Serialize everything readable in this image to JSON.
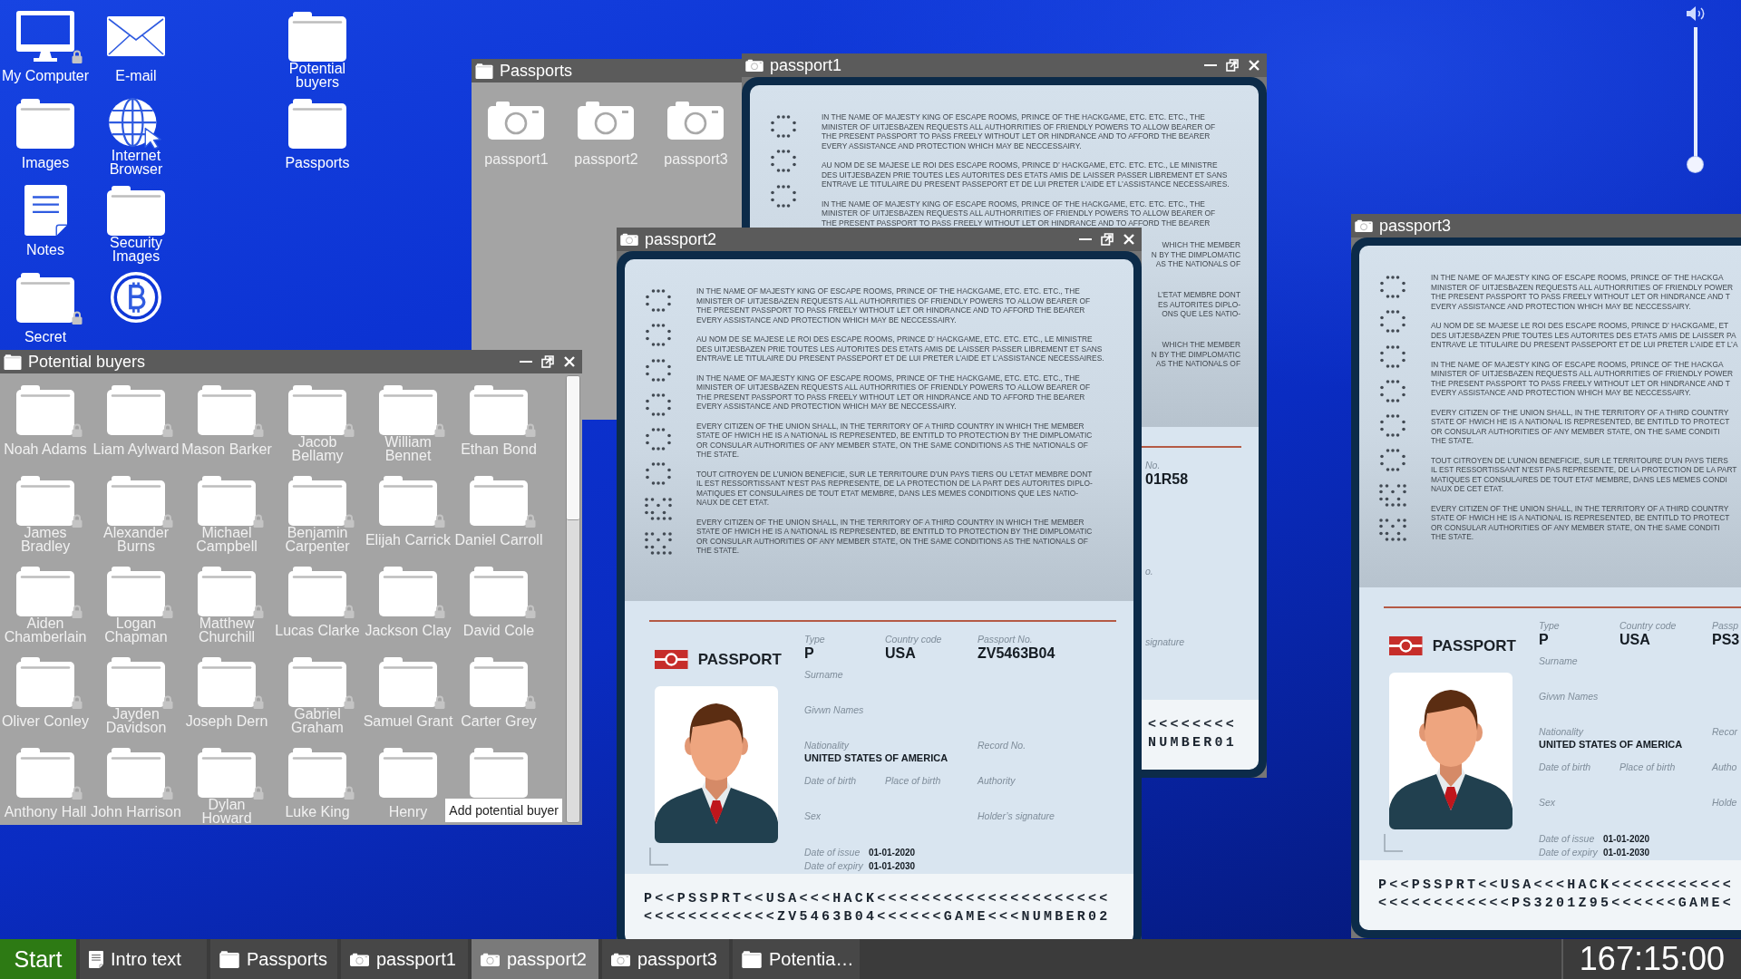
{
  "desktop_icons": [
    [
      {
        "label": "My Computer",
        "kind": "computer",
        "locked": true
      },
      {
        "label": "Images",
        "kind": "folder",
        "locked": false
      },
      {
        "label": "Notes",
        "kind": "note",
        "locked": false
      },
      {
        "label": "Secret",
        "kind": "folder",
        "locked": true
      }
    ],
    [
      {
        "label": "E-mail",
        "kind": "mail",
        "locked": false
      },
      {
        "label": "Internet Browser",
        "kind": "browser",
        "locked": false
      },
      {
        "label": "Security Images",
        "kind": "folder",
        "locked": false
      },
      {
        "kind": "bitcoin",
        "locked": false
      }
    ],
    [
      {
        "label": "Potential buyers",
        "kind": "folder",
        "locked": false
      },
      {
        "label": "Passports",
        "kind": "folder",
        "locked": false
      }
    ]
  ],
  "volume": {
    "level": 0
  },
  "windows": [
    {
      "kind": "folder",
      "title": "Passports",
      "controls": false,
      "scrollable": false,
      "items": [
        {
          "label": "passport1",
          "kind": "image"
        },
        {
          "label": "passport2",
          "kind": "image"
        },
        {
          "label": "passport3",
          "kind": "image"
        }
      ]
    },
    {
      "kind": "folder",
      "title": "Potential buyers",
      "controls": true,
      "scrollable": true,
      "items": [
        {
          "label": "Noah Adams",
          "kind": "folder",
          "locked": true
        },
        {
          "label": "Liam Aylward",
          "kind": "folder",
          "locked": true
        },
        {
          "label": "Mason Barker",
          "kind": "folder",
          "locked": true
        },
        {
          "label": "Jacob Bellamy",
          "kind": "folder",
          "locked": true
        },
        {
          "label": "William Bennet",
          "kind": "folder",
          "locked": true
        },
        {
          "label": "Ethan Bond",
          "kind": "folder",
          "locked": true
        },
        {
          "label": "James Bradley",
          "kind": "folder",
          "locked": true
        },
        {
          "label": "Alexander Burns",
          "kind": "folder",
          "locked": true
        },
        {
          "label": "Michael Campbell",
          "kind": "folder",
          "locked": true
        },
        {
          "label": "Benjamin Carpenter",
          "kind": "folder",
          "locked": true
        },
        {
          "label": "Elijah Carrick",
          "kind": "folder",
          "locked": true
        },
        {
          "label": "Daniel Carroll",
          "kind": "folder",
          "locked": true
        },
        {
          "label": "Aiden Chamberlain",
          "kind": "folder",
          "locked": true
        },
        {
          "label": "Logan Chapman",
          "kind": "folder",
          "locked": true
        },
        {
          "label": "Matthew Churchill",
          "kind": "folder",
          "locked": true
        },
        {
          "label": "Lucas Clarke",
          "kind": "folder",
          "locked": true
        },
        {
          "label": "Jackson Clay",
          "kind": "folder",
          "locked": true
        },
        {
          "label": "David Cole",
          "kind": "folder",
          "locked": true
        },
        {
          "label": "Oliver Conley",
          "kind": "folder",
          "locked": true
        },
        {
          "label": "Jayden Davidson",
          "kind": "folder",
          "locked": true
        },
        {
          "label": "Joseph Dern",
          "kind": "folder",
          "locked": true
        },
        {
          "label": "Gabriel Graham",
          "kind": "folder",
          "locked": true
        },
        {
          "label": "Samuel Grant",
          "kind": "folder",
          "locked": true
        },
        {
          "label": "Carter Grey",
          "kind": "folder",
          "locked": true
        },
        {
          "label": "Anthony Hall",
          "kind": "folder",
          "locked": true
        },
        {
          "label": "John Harrison",
          "kind": "folder",
          "locked": true
        },
        {
          "label": "Dylan Howard",
          "kind": "folder",
          "locked": true
        },
        {
          "label": "Luke King",
          "kind": "folder",
          "locked": true
        },
        {
          "label": "Henry",
          "kind": "folder",
          "locked": false
        },
        {
          "kind": "folder",
          "locked": false
        }
      ],
      "button": "Add potential buyer"
    },
    {
      "kind": "image",
      "title": "passport1",
      "controls": true,
      "passport": {
        "security_marks": [
          {
            "kind": "ring"
          },
          {
            "kind": "ring"
          },
          {
            "kind": "ring"
          }
        ],
        "paragraphs": [
          [
            "IN THE NAME OF MAJESTY KING OF ESCAPE ROOMS, PRINCE OF THE HACKGAME, ETC. ETC. ETC., THE",
            "MINISTER OF UITJESBAZEN REQUESTS ALL AUTHORRITIES OF FRIENDLY POWERS TO ALLOW BEARER OF",
            "THE PRESENT PASSPORT TO PASS FREELY WITHOUT LET OR HINDRANCE AND TO AFFORD THE BEARER",
            "EVERY ASSISTANCE AND PROTECTION WHICH MAY BE NECCESSAIRY."
          ],
          [
            "AU NOM DE SE MAJESE LE ROI DES ESCAPE ROOMS, PRINCE D’ HACKGAME, ETC. ETC. ETC., LE MINISTRE",
            "DES UITJESBAZEN PRIE TOUTES LES AUTORITES DES ETATS AMIS DE LAISSER PASSER LIBREMENT ET SANS",
            "ENTRAVE LE TITULAIRE DU PRESENT PASSEPORT ET DE LUI PRETER L’AIDE ET L’ASSISTANCE NECESSAIRES."
          ],
          [
            "IN THE NAME OF MAJESTY KING OF ESCAPE ROOMS, PRINCE OF THE HACKGAME, ETC. ETC. ETC., THE",
            "MINISTER OF UITJESBAZEN REQUESTS ALL AUTHORRITIES OF FRIENDLY POWERS TO ALLOW BEARER OF",
            "THE PRESENT PASSPORT TO PASS FREELY WITHOUT LET OR HINDRANCE AND TO AFFORD THE BEARER"
          ]
        ],
        "paragraph_ends": [
          [
            "WHICH THE MEMBER",
            "N BY THE DIMPLOMATIC",
            "AS THE NATIONALS OF"
          ],
          [
            "L’ETAT MEMBRE DONT",
            "ES AUTORITES DIPLO-",
            "ONS QUE LES NATIO-"
          ],
          [
            "WHICH THE MEMBER",
            "N BY THE DIMPLOMATIC",
            "AS THE NATIONALS OF"
          ]
        ],
        "photo": false,
        "fields": {
          "passport_no": {
            "label": "No.",
            "value": "01R58"
          },
          "record_no": {
            "label": "o."
          },
          "holder_signature": {
            "label": "signature"
          }
        },
        "mrz": [
          "<<<<<<<<",
          "NUMBER01"
        ]
      }
    },
    {
      "kind": "image",
      "title": "passport3",
      "controls": false,
      "passport": {
        "security_marks": [
          {
            "kind": "ring"
          },
          {
            "kind": "ring"
          },
          {
            "kind": "ring"
          },
          {
            "kind": "ring"
          },
          {
            "kind": "ring"
          },
          {
            "kind": "ring"
          },
          {
            "kind": "grid"
          },
          {
            "kind": "grid"
          }
        ],
        "paragraphs": [
          [
            "IN THE NAME OF MAJESTY KING OF ESCAPE ROOMS, PRINCE OF THE HACKGA",
            "MINISTER OF UITJESBAZEN REQUESTS ALL AUTHORRITIES OF FRIENDLY POWER",
            "THE PRESENT PASSPORT TO PASS FREELY WITHOUT LET OR HINDRANCE AND T",
            "EVERY ASSISTANCE AND PROTECTION WHICH MAY BE NECCESSAIRY."
          ],
          [
            "AU NOM DE SE MAJESE LE ROI DES ESCAPE ROOMS, PRINCE D’ HACKGAME, ET",
            "DES UITJESBAZEN PRIE TOUTES LES AUTORITES DES ETATS AMIS DE LAISSER PA",
            "ENTRAVE LE TITULAIRE DU PRESENT PASSEPORT ET DE LUI PRETER L’AIDE ET L’A"
          ],
          [
            "IN THE NAME OF MAJESTY KING OF ESCAPE ROOMS, PRINCE OF THE HACKGA",
            "MINISTER OF UITJESBAZEN REQUESTS ALL AUTHORRITIES OF FRIENDLY POWER",
            "THE PRESENT PASSPORT TO PASS FREELY WITHOUT LET OR HINDRANCE AND T",
            "EVERY ASSISTANCE AND PROTECTION WHICH MAY BE NECCESSAIRY."
          ],
          [
            "EVERY CITIZEN OF THE UNION SHALL, IN THE TERRITORY OF A THIRD COUNTRY",
            "STATE OF HWICH HE IS A NATIONAL IS REPRESENTED, BE ENTITLD TO PROTECT",
            "OR CONSULAR AUTHORITIES OF ANY MEMBER STATE, ON THE SAME CONDITI",
            "THE STATE."
          ],
          [
            "TOUT CITROYEN DE L’UNION BENEFICIE, SUR LE TERRITOURE D’UN PAYS TIERS",
            "IL EST RESSORTISSANT N’EST PAS REPRESENTE, DE LA PROTECTION DE LA PART",
            "MATIQUES ET CONSULAIRES DE TOUT ETAT MEMBRE, DANS LES MEMES CONDI",
            "NAUX DE CET ETAT."
          ],
          [
            "EVERY CITIZEN OF THE UNION SHALL, IN THE TERRITORY OF A THIRD COUNTRY",
            "STATE OF HWICH HE IS A NATIONAL IS REPRESENTED, BE ENTITLD TO PROTECT",
            "OR CONSULAR AUTHORITIES OF ANY MEMBER STATE, ON THE SAME CONDITI",
            "THE STATE."
          ]
        ],
        "header": "PASSPORT",
        "photo": true,
        "fields": {
          "type": {
            "label": "Type",
            "value": "P"
          },
          "country_code": {
            "label": "Country code",
            "value": "USA"
          },
          "passport_no": {
            "label": "Passp",
            "value": "PS3"
          },
          "surname": {
            "label": "Surname"
          },
          "given_names": {
            "label": "Givwn Names"
          },
          "nationality": {
            "label": "Nationality",
            "value": "UNITED STATES OF AMERICA"
          },
          "record_no": {
            "label": "Recor"
          },
          "date_of_birth": {
            "label": "Date of birth"
          },
          "place_of_birth": {
            "label": "Place of birth"
          },
          "authority": {
            "label": "Autho"
          },
          "sex": {
            "label": "Sex"
          },
          "holder_signature": {
            "label": "Holde"
          },
          "date_of_issue": {
            "label": "Date of issue",
            "value": "01-01-2020"
          },
          "date_of_expiry": {
            "label": "Date of expiry",
            "value": "01-01-2030"
          }
        },
        "mrz": [
          "P<<PSSPRT<<USA<<<HACK<<<<<<<<<<<",
          "<<<<<<<<<<<<PS3201Z95<<<<<<GAME<"
        ]
      }
    },
    {
      "kind": "image",
      "title": "passport2",
      "controls": true,
      "passport": {
        "security_marks": [
          {
            "kind": "ring"
          },
          {
            "kind": "ring"
          },
          {
            "kind": "ring"
          },
          {
            "kind": "ring"
          },
          {
            "kind": "ring"
          },
          {
            "kind": "ring"
          },
          {
            "kind": "grid"
          },
          {
            "kind": "grid"
          }
        ],
        "paragraphs": [
          [
            "IN THE NAME OF MAJESTY KING OF ESCAPE ROOMS, PRINCE OF THE HACKGAME, ETC. ETC. ETC., THE",
            "MINISTER OF UITJESBAZEN REQUESTS ALL AUTHORRITIES OF FRIENDLY POWERS TO ALLOW BEARER OF",
            "THE PRESENT PASSPORT TO PASS FREELY WITHOUT LET OR HINDRANCE AND TO AFFORD THE BEARER",
            "EVERY ASSISTANCE AND PROTECTION WHICH MAY BE NECCESSAIRY."
          ],
          [
            "AU NOM DE SE MAJESE LE ROI DES ESCAPE ROOMS, PRINCE D’ HACKGAME, ETC. ETC. ETC., LE MINISTRE",
            "DES UITJESBAZEN PRIE TOUTES LES AUTORITES DES ETATS AMIS DE LAISSER PASSER LIBREMENT ET SANS",
            "ENTRAVE LE TITULAIRE DU PRESENT PASSEPORT ET DE LUI PRETER L’AIDE ET L’ASSISTANCE NECESSAIRES."
          ],
          [
            "IN THE NAME OF MAJESTY KING OF ESCAPE ROOMS, PRINCE OF THE HACKGAME, ETC. ETC. ETC., THE",
            "MINISTER OF UITJESBAZEN REQUESTS ALL AUTHORRITIES OF FRIENDLY POWERS TO ALLOW BEARER OF",
            "THE PRESENT PASSPORT TO PASS FREELY WITHOUT LET OR HINDRANCE AND TO AFFORD THE BEARER",
            "EVERY ASSISTANCE AND PROTECTION WHICH MAY BE NECCESSAIRY."
          ],
          [
            "EVERY CITIZEN OF THE UNION SHALL, IN THE TERRITORY OF A THIRD COUNTRY IN WHICH THE MEMBER",
            "STATE OF HWICH HE IS A NATIONAL IS REPRESENTED, BE ENTITLD TO PROTECTION BY THE DIMPLOMATIC",
            "OR CONSULAR AUTHORITIES OF ANY MEMBER STATE, ON THE SAME CONDITIONS AS THE NATIONALS OF",
            "THE STATE."
          ],
          [
            "TOUT CITROYEN DE L’UNION BENEFICIE, SUR LE TERRITOURE D’UN PAYS TIERS OU L’ETAT MEMBRE DONT",
            "IL EST RESSORTISSANT N’EST PAS REPRESENTE, DE LA PROTECTION DE LA PART DES AUTORITES DIPLO-",
            "MATIQUES ET CONSULAIRES DE TOUT ETAT MEMBRE, DANS LES MEMES CONDITIONS QUE LES NATIO-",
            "NAUX DE CET ETAT."
          ],
          [
            "EVERY CITIZEN OF THE UNION SHALL, IN THE TERRITORY OF A THIRD COUNTRY IN WHICH THE MEMBER",
            "STATE OF HWICH HE IS A NATIONAL IS REPRESENTED, BE ENTITLD TO PROTECTION BY THE DIMPLOMATIC",
            "OR CONSULAR AUTHORITIES OF ANY MEMBER STATE, ON THE SAME CONDITIONS AS THE NATIONALS OF",
            "THE STATE."
          ]
        ],
        "header": "PASSPORT",
        "photo": true,
        "fields": {
          "type": {
            "label": "Type",
            "value": "P"
          },
          "country_code": {
            "label": "Country code",
            "value": "USA"
          },
          "passport_no": {
            "label": "Passport No.",
            "value": "ZV5463B04"
          },
          "surname": {
            "label": "Surname"
          },
          "given_names": {
            "label": "Givwn Names"
          },
          "nationality": {
            "label": "Nationality",
            "value": "UNITED STATES OF AMERICA"
          },
          "record_no": {
            "label": "Record No."
          },
          "date_of_birth": {
            "label": "Date of birth"
          },
          "place_of_birth": {
            "label": "Place of birth"
          },
          "authority": {
            "label": "Authority"
          },
          "sex": {
            "label": "Sex"
          },
          "holder_signature": {
            "label": "Holder’s signature"
          },
          "date_of_issue": {
            "label": "Date of issue",
            "value": "01-01-2020"
          },
          "date_of_expiry": {
            "label": "Date of expiry",
            "value": "01-01-2030"
          }
        },
        "mrz": [
          "P<<PSSPRT<<USA<<<HACK<<<<<<<<<<<<<<<<<<<<<",
          "<<<<<<<<<<<<ZV5463B04<<<<<<GAME<<<NUMBER02"
        ]
      }
    }
  ],
  "taskbar": {
    "start": "Start",
    "items": [
      {
        "label": "Intro text",
        "kind": "note",
        "selected": false
      },
      {
        "label": "Passports",
        "kind": "folder",
        "selected": false
      },
      {
        "label": "passport1",
        "kind": "image",
        "selected": false
      },
      {
        "label": "passport2",
        "kind": "image",
        "selected": true
      },
      {
        "label": "passport3",
        "kind": "image",
        "selected": false
      },
      {
        "label": "Potentia…",
        "kind": "folder",
        "selected": false
      }
    ],
    "clock": "167:15:00"
  }
}
